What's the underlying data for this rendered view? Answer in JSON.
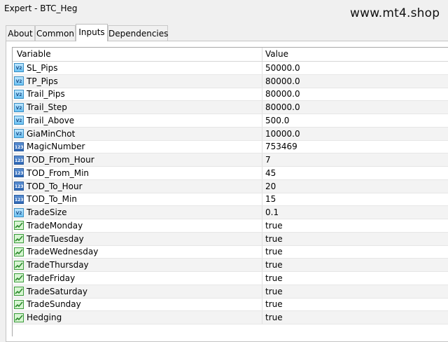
{
  "window": {
    "title": "Expert - BTC_Heg"
  },
  "watermark": "www.mt4.shop",
  "tabs": [
    {
      "label": "About"
    },
    {
      "label": "Common"
    },
    {
      "label": "Inputs",
      "active": true
    },
    {
      "label": "Dependencies"
    }
  ],
  "table": {
    "headers": {
      "variable": "Variable",
      "value": "Value"
    },
    "rows": [
      {
        "name": "SL_Pips",
        "value": "50000.0",
        "type": "double-icon"
      },
      {
        "name": "TP_Pips",
        "value": "80000.0",
        "type": "double-icon"
      },
      {
        "name": "Trail_Pips",
        "value": "80000.0",
        "type": "double-icon"
      },
      {
        "name": "Trail_Step",
        "value": "80000.0",
        "type": "double-icon"
      },
      {
        "name": "Trail_Above",
        "value": "500.0",
        "type": "double-icon"
      },
      {
        "name": "GiaMinChot",
        "value": "10000.0",
        "type": "double-icon"
      },
      {
        "name": "MagicNumber",
        "value": "753469",
        "type": "int-icon"
      },
      {
        "name": "TOD_From_Hour",
        "value": "7",
        "type": "int-icon"
      },
      {
        "name": "TOD_From_Min",
        "value": "45",
        "type": "int-icon"
      },
      {
        "name": "TOD_To_Hour",
        "value": "20",
        "type": "int-icon"
      },
      {
        "name": "TOD_To_Min",
        "value": "15",
        "type": "int-icon"
      },
      {
        "name": "TradeSize",
        "value": "0.1",
        "type": "double-icon"
      },
      {
        "name": "TradeMonday",
        "value": "true",
        "type": "bool-icon"
      },
      {
        "name": "TradeTuesday",
        "value": "true",
        "type": "bool-icon"
      },
      {
        "name": "TradeWednesday",
        "value": "true",
        "type": "bool-icon"
      },
      {
        "name": "TradeThursday",
        "value": "true",
        "type": "bool-icon"
      },
      {
        "name": "TradeFriday",
        "value": "true",
        "type": "bool-icon"
      },
      {
        "name": "TradeSaturday",
        "value": "true",
        "type": "bool-icon"
      },
      {
        "name": "TradeSunday",
        "value": "true",
        "type": "bool-icon"
      },
      {
        "name": "Hedging",
        "value": "true",
        "type": "bool-icon"
      }
    ]
  }
}
